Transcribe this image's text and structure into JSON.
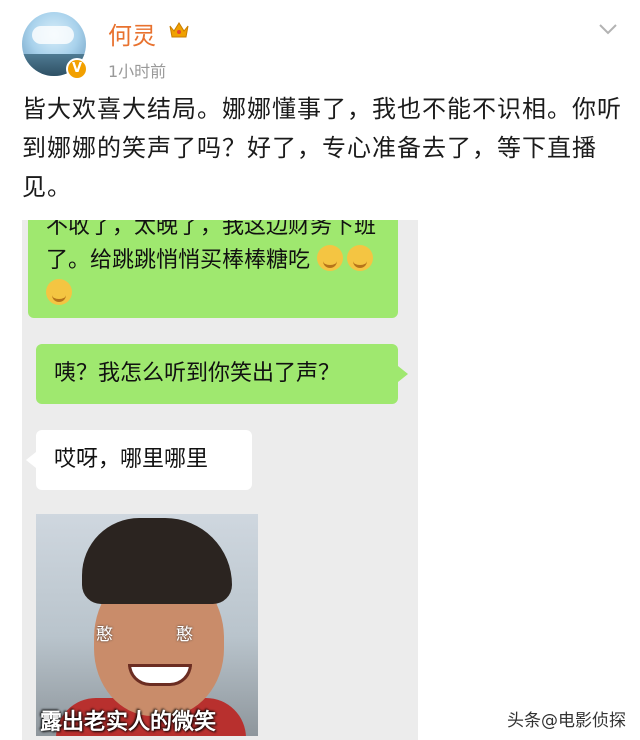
{
  "post": {
    "username": "何灵",
    "timestamp": "1小时前",
    "text": "皆大欢喜大结局。娜娜懂事了，我也不能不识相。你听到娜娜的笑声了吗？好了，专心准备去了，等下直播见。"
  },
  "chat": {
    "messages": [
      {
        "side": "right",
        "text": "不收了，太晚了，我这边财务下班了。给跳跳悄悄买棒棒糖吃"
      },
      {
        "side": "right",
        "text": "咦？我怎么听到你笑出了声？"
      },
      {
        "side": "left",
        "text": "哎呀，哪里哪里"
      }
    ],
    "meme": {
      "tag_left": "憨",
      "tag_right": "憨",
      "caption": "露出老实人的微笑"
    }
  },
  "watermark": "头条@电影侦探",
  "colors": {
    "username": "#e8722f",
    "bubble_green": "#9fe86f",
    "chat_bg": "#ececec",
    "verified": "#f2a000"
  },
  "icons": {
    "verified": "verified-v-icon",
    "crown": "crown-icon",
    "more": "chevron-down-icon",
    "emoji": "grin-emoji-icon"
  }
}
